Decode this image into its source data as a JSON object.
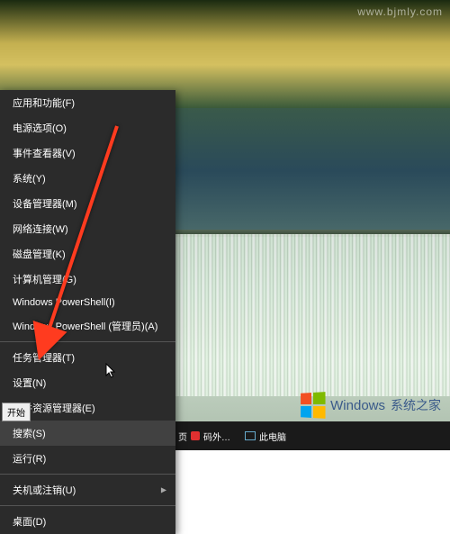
{
  "url_watermark": "www.bjmly.com",
  "menu": {
    "items": [
      {
        "label": "应用和功能(F)"
      },
      {
        "label": "电源选项(O)"
      },
      {
        "label": "事件查看器(V)"
      },
      {
        "label": "系统(Y)"
      },
      {
        "label": "设备管理器(M)"
      },
      {
        "label": "网络连接(W)"
      },
      {
        "label": "磁盘管理(K)"
      },
      {
        "label": "计算机管理(G)"
      },
      {
        "label": "Windows PowerShell(I)"
      },
      {
        "label": "Windows PowerShell (管理员)(A)"
      }
    ],
    "items2": [
      {
        "label": "任务管理器(T)"
      },
      {
        "label": "设置(N)"
      },
      {
        "label": "文件资源管理器(E)"
      },
      {
        "label": "搜索(S)",
        "highlighted": true
      },
      {
        "label": "运行(R)"
      }
    ],
    "items3": [
      {
        "label": "关机或注销(U)",
        "submenu": true
      }
    ],
    "items4": [
      {
        "label": "桌面(D)"
      }
    ]
  },
  "tooltip": {
    "start": "开始"
  },
  "taskbar": {
    "item1_prefix": "页",
    "item1_suffix": "码外…",
    "item2": "此电脑"
  },
  "watermark": {
    "brand": "Windows",
    "sub": "系统之家"
  }
}
